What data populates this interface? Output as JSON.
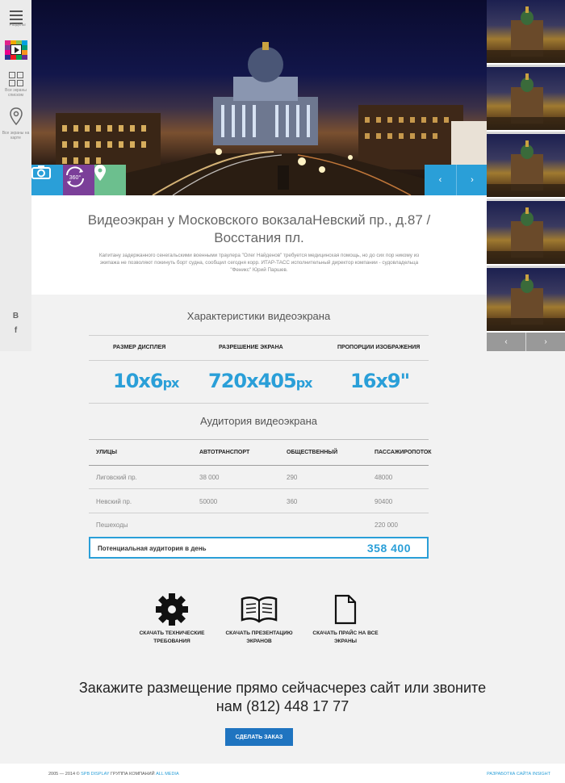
{
  "sidebar": {
    "menu_label": "Разделы",
    "all_list_label": "Все экраны списком",
    "all_map_label": "Все экраны на карте",
    "social": [
      "B",
      "f"
    ]
  },
  "hero": {
    "buttons": [
      {
        "icon": "camera-icon",
        "color": "#2a9fd8"
      },
      {
        "icon": "panorama-360-icon",
        "label": "360°",
        "color": "#7b3f99"
      },
      {
        "icon": "map-pin-icon",
        "color": "#6cbf8e"
      }
    ],
    "prev": "‹",
    "next": "›"
  },
  "thumbs_nav": {
    "prev": "‹",
    "next": "›"
  },
  "screen": {
    "title": "Видеоэкран у Московского вокзалаНевский пр., д.87 / Восстания пл.",
    "description": "Капитану задержанного сенегальскими военными траулера \"Олег Найденов\" требуется медицинская помощь, но до сих пор никому из экипажа не позволяют покинуть борт судна, сообщил сегодня корр. ИТАР-ТАСС исполнительный директор компании - судовладельца \"Феникс\" Юрий Паршев."
  },
  "specs": {
    "heading": "Характеристики видеоэкрана",
    "columns": [
      {
        "label": "РАЗМЕР ДИСПЛЕЯ",
        "value": "10x6",
        "unit": "px"
      },
      {
        "label": "РАЗРЕШЕНИЕ ЭКРАНА",
        "value": "720x405",
        "unit": "px"
      },
      {
        "label": "ПРОПОРЦИИ ИЗОБРАЖЕНИЯ",
        "value": "16x9\"",
        "unit": ""
      }
    ]
  },
  "audience": {
    "heading": "Аудитория видеоэкрана",
    "headers": [
      "УЛИЦЫ",
      "АВТОТРАНСПОРТ",
      "ОБЩЕСТВЕННЫЙ",
      "ПАССАЖИРОПОТОК"
    ],
    "rows": [
      [
        "Лиговский пр.",
        "38 000",
        "290",
        "48000"
      ],
      [
        "Невский пр.",
        "50000",
        "360",
        "90400"
      ],
      [
        "Пешеходы",
        "",
        "",
        "220 000"
      ]
    ],
    "total_label": "Потенциальная аудитория в день",
    "total_value": "358 400"
  },
  "downloads": [
    {
      "icon": "gear-icon",
      "label": "СКАЧАТЬ ТЕХНИЧЕСКИЕ ТРЕБОВАНИЯ"
    },
    {
      "icon": "book-icon",
      "label": "СКАЧАТЬ ПРЕЗЕНТАЦИЮ ЭКРАНОВ"
    },
    {
      "icon": "document-icon",
      "label": "СКАЧАТЬ ПРАЙС НА ВСЕ ЭКРАНЫ"
    }
  ],
  "cta": {
    "text": "Закажите размещение прямо сейчасчерез сайт или звоните нам (812) 448 17 77",
    "button": "СДЕЛАТЬ ЗАКАЗ"
  },
  "footer": {
    "years": "2005 — 2014 ©",
    "brand": "SPB DISPLAY",
    "group": "ГРУППА КОМПАНИЙ",
    "group_name": "ALL MEDIA",
    "dev": "РАЗРАБОТКА САЙТА INSIGHT"
  },
  "colors": {
    "accent": "#2a9fd8",
    "button": "#1f74c0",
    "purple": "#7b3f99",
    "green": "#6cbf8e"
  }
}
